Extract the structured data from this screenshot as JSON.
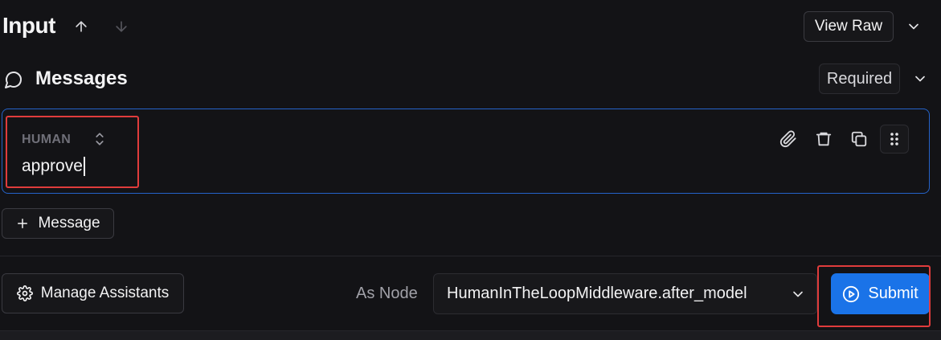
{
  "header": {
    "title": "Input",
    "view_raw_label": "View Raw"
  },
  "messages": {
    "title": "Messages",
    "required_label": "Required",
    "items": [
      {
        "role": "HUMAN",
        "content": "approve"
      }
    ],
    "add_message_label": "Message"
  },
  "footer": {
    "manage_assistants_label": "Manage Assistants",
    "as_node_label": "As Node",
    "selected_node": "HumanInTheLoopMiddleware.after_model",
    "submit_label": "Submit"
  },
  "colors": {
    "accent": "#1a73e8",
    "card_border": "#2563c9",
    "highlight": "#e03c3c",
    "background": "#131316"
  },
  "icons": [
    "arrow-up-icon",
    "arrow-down-icon",
    "chevron-down-icon",
    "chat-bubble-icon",
    "sort-icon",
    "paperclip-icon",
    "trash-icon",
    "copy-icon",
    "drag-handle-icon",
    "plus-icon",
    "gear-icon",
    "play-circle-icon"
  ]
}
